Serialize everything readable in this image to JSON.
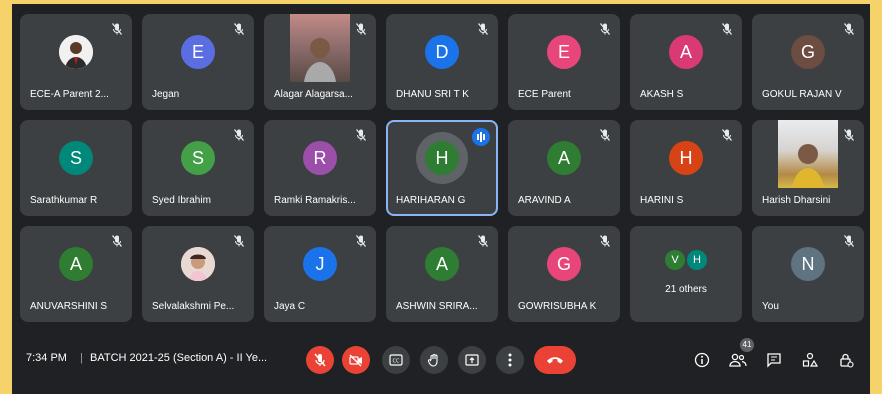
{
  "tiles": [
    {
      "name": "ECE-A Parent 2...",
      "avatar": "",
      "type": "photo",
      "muted": true
    },
    {
      "name": "Jegan",
      "avatar": "E",
      "color": "#5b6ee1",
      "muted": true
    },
    {
      "name": "Alagar Alagarsa...",
      "avatar": "",
      "type": "video",
      "muted": true
    },
    {
      "name": "DHANU SRI T K",
      "avatar": "D",
      "color": "#1a73e8",
      "muted": true
    },
    {
      "name": "ECE Parent",
      "avatar": "E",
      "color": "#e8467a",
      "muted": true
    },
    {
      "name": "AKASH S",
      "avatar": "A",
      "color": "#d93a73",
      "muted": true
    },
    {
      "name": "GOKUL RAJAN V",
      "avatar": "G",
      "color": "#6d4c41",
      "muted": true
    },
    {
      "name": "Sarathkumar R",
      "avatar": "S",
      "color": "#00897b",
      "muted": false
    },
    {
      "name": "Syed Ibrahim",
      "avatar": "S",
      "color": "#43a047",
      "muted": true
    },
    {
      "name": "Ramki Ramakris...",
      "avatar": "R",
      "color": "#9c4fa8",
      "muted": true
    },
    {
      "name": "HARIHARAN G",
      "avatar": "H",
      "color": "#2e7d32",
      "muted": false,
      "active": true
    },
    {
      "name": "ARAVIND A",
      "avatar": "A",
      "color": "#2e7d32",
      "muted": true
    },
    {
      "name": "HARINI S",
      "avatar": "H",
      "color": "#d84315",
      "muted": true
    },
    {
      "name": "Harish Dharsini",
      "avatar": "",
      "type": "video2",
      "muted": true
    },
    {
      "name": "ANUVARSHINI S",
      "avatar": "A",
      "color": "#2e7d32",
      "muted": true
    },
    {
      "name": "Selvalakshmi Pe...",
      "avatar": "",
      "type": "photo2",
      "muted": true
    },
    {
      "name": "Jaya C",
      "avatar": "J",
      "color": "#1a73e8",
      "muted": true
    },
    {
      "name": "ASHWIN SRIRA...",
      "avatar": "A",
      "color": "#2e7d32",
      "muted": true
    },
    {
      "name": "GOWRISUBHA K",
      "avatar": "G",
      "color": "#e8467a",
      "muted": true
    },
    {
      "name": "",
      "avatar": "",
      "type": "others",
      "muted": false
    },
    {
      "name": "You",
      "avatar": "N",
      "color": "#5f7380",
      "muted": true
    }
  ],
  "others": {
    "label": "21 others",
    "a": "V",
    "b": "H",
    "a_color": "#2e7d32",
    "b_color": "#00897b"
  },
  "bar": {
    "time": "7:34 PM",
    "separator": "|",
    "meeting": "BATCH 2021-25 (Section A) - II Ye...",
    "participant_count": "41"
  },
  "icons": {
    "mic": "mic-off-icon",
    "cam": "camera-off-icon",
    "cc": "captions-icon",
    "hand": "raise-hand-icon",
    "present": "present-icon",
    "more": "more-icon",
    "end": "end-call-icon",
    "info": "info-icon",
    "people": "people-icon",
    "chat": "chat-icon",
    "activities": "activities-icon",
    "lock": "host-controls-icon"
  }
}
